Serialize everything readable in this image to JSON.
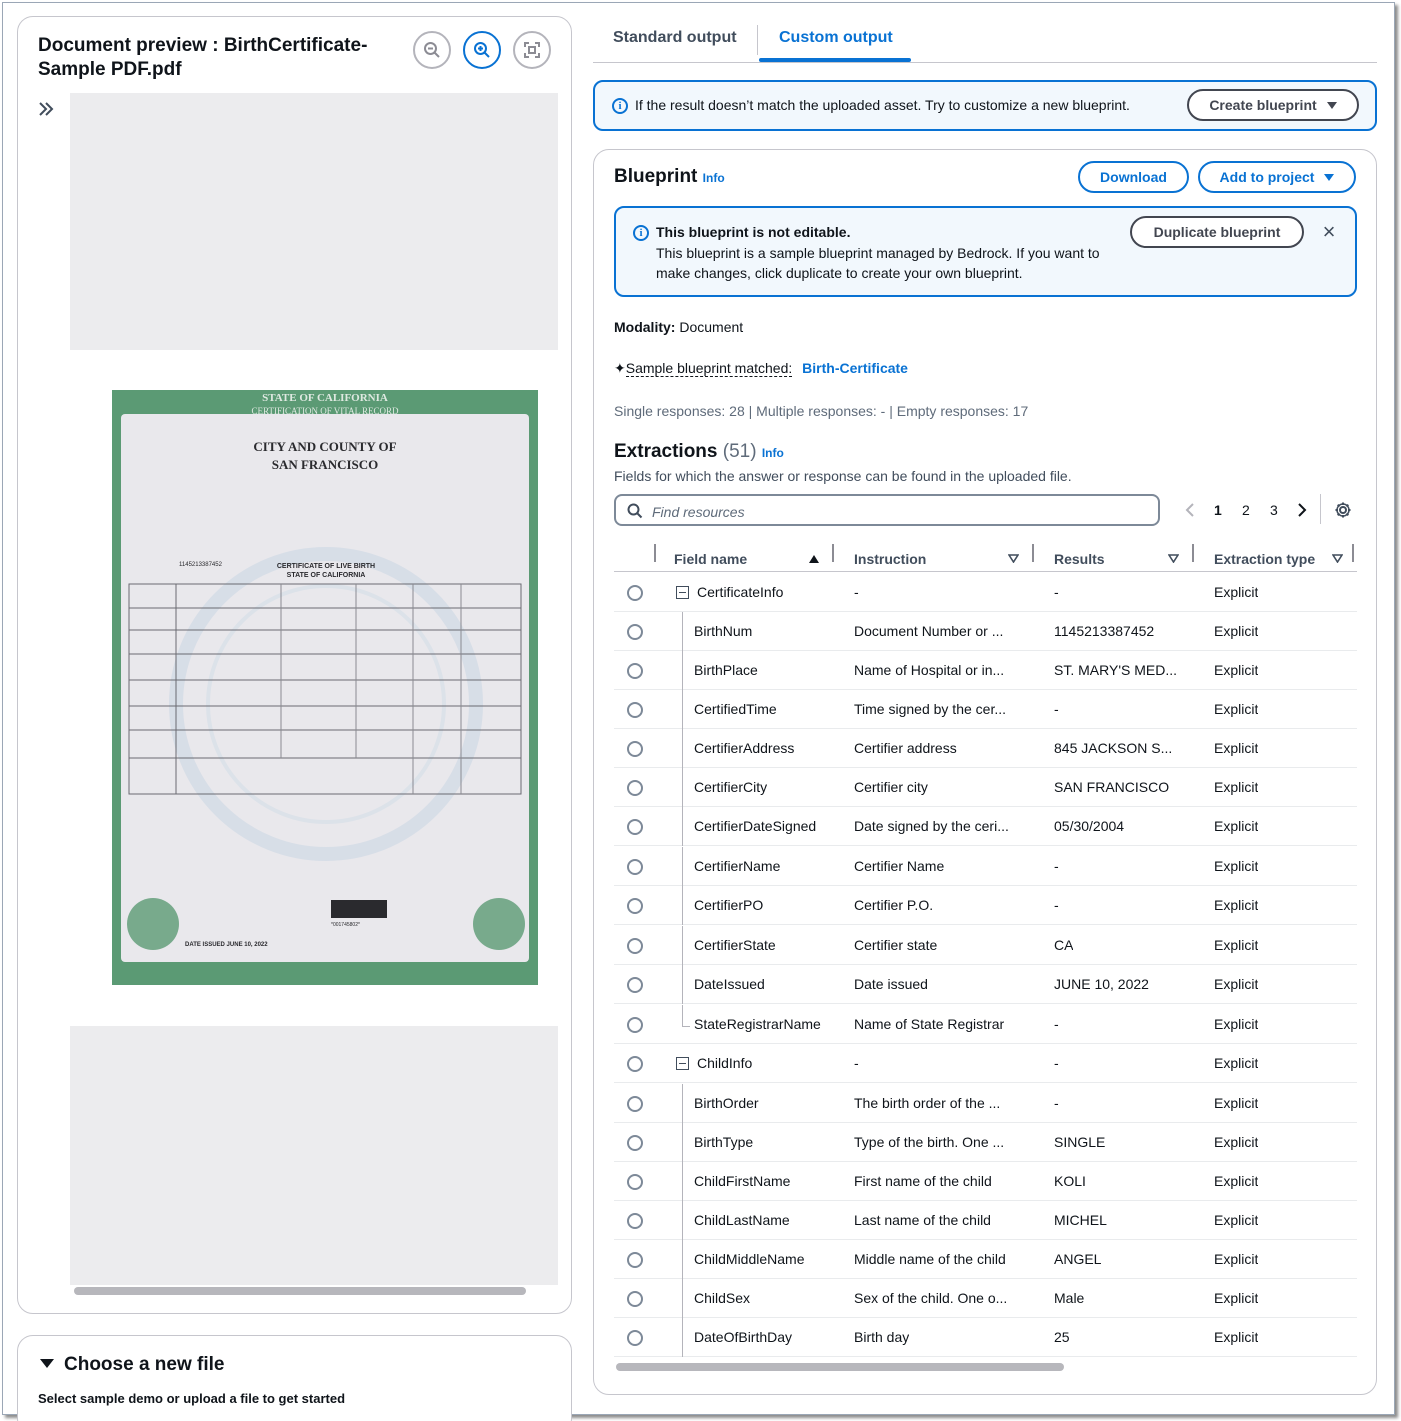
{
  "preview": {
    "title": "Document preview : BirthCertificate-Sample PDF.pdf",
    "zoom_out_icon": "zoom-out-icon",
    "zoom_in_icon": "zoom-in-icon",
    "fit_icon": "fit-screen-icon",
    "expand_icon": "double-chevron-right-icon",
    "document": {
      "header_line1": "STATE OF CALIFORNIA",
      "header_line2": "CERTIFICATION OF VITAL RECORD",
      "county_line1": "CITY AND COUNTY OF",
      "county_line2": "SAN FRANCISCO",
      "cert_title1": "CERTIFICATE OF LIVE BIRTH",
      "cert_title2": "STATE OF CALIFORNIA",
      "state_file_number": "1145213387452",
      "date_issued": "DATE ISSUED  JUNE 10, 2022",
      "barcode_number": "*001745802*",
      "colors": {
        "border": "#5b9a74",
        "paper": "#e9e8ec"
      }
    }
  },
  "choose_file": {
    "title": "Choose a new file",
    "subtitle": "Select sample demo or upload a file to get started"
  },
  "tabs": [
    {
      "label": "Standard output",
      "active": false
    },
    {
      "label": "Custom output",
      "active": true
    }
  ],
  "info_banner": {
    "text": "If the result doesn’t match the uploaded asset. Try to customize a new blueprint.",
    "button": "Create blueprint"
  },
  "blueprint": {
    "title": "Blueprint",
    "info": "Info",
    "download": "Download",
    "add_to_project": "Add to project",
    "alert": {
      "title": "This blueprint is not editable.",
      "body": "This blueprint is a sample blueprint managed by Bedrock. If you want to make changes, click duplicate to create your own blueprint.",
      "button": "Duplicate blueprint"
    },
    "modality_label": "Modality:",
    "modality_value": "Document",
    "matched_label": "Sample blueprint matched:",
    "matched_value": "Birth-Certificate",
    "stats": "Single responses: 28 | Multiple responses: - | Empty responses: 17"
  },
  "extractions": {
    "title": "Extractions",
    "count": "(51)",
    "info": "Info",
    "description": "Fields for which the answer or response can be found in the uploaded file.",
    "search_placeholder": "Find resources",
    "pages": [
      "1",
      "2",
      "3"
    ],
    "current_page": "1",
    "columns": [
      "Field name",
      "Instruction",
      "Results",
      "Extraction type"
    ],
    "rows": [
      {
        "field": "CertificateInfo",
        "instruction": "-",
        "result": "-",
        "type": "Explicit",
        "group": true
      },
      {
        "field": "BirthNum",
        "instruction": "Document Number or ...",
        "result": "1145213387452",
        "type": "Explicit"
      },
      {
        "field": "BirthPlace",
        "instruction": "Name of Hospital or in...",
        "result": "ST. MARY'S MED...",
        "type": "Explicit"
      },
      {
        "field": "CertifiedTime",
        "instruction": "Time signed by the cer...",
        "result": "-",
        "type": "Explicit"
      },
      {
        "field": "CertifierAddress",
        "instruction": "Certifier address",
        "result": "845 JACKSON S...",
        "type": "Explicit"
      },
      {
        "field": "CertifierCity",
        "instruction": "Certifier city",
        "result": "SAN FRANCISCO",
        "type": "Explicit"
      },
      {
        "field": "CertifierDateSigned",
        "instruction": "Date signed by the ceri...",
        "result": "05/30/2004",
        "type": "Explicit"
      },
      {
        "field": "CertifierName",
        "instruction": "Certifier Name",
        "result": "-",
        "type": "Explicit"
      },
      {
        "field": "CertifierPO",
        "instruction": "Certifier P.O.",
        "result": "-",
        "type": "Explicit"
      },
      {
        "field": "CertifierState",
        "instruction": "Certifier state",
        "result": "CA",
        "type": "Explicit"
      },
      {
        "field": "DateIssued",
        "instruction": "Date issued",
        "result": "JUNE 10, 2022",
        "type": "Explicit"
      },
      {
        "field": "StateRegistrarName",
        "instruction": "Name of State Registrar",
        "result": "-",
        "type": "Explicit",
        "last": true
      },
      {
        "field": "ChildInfo",
        "instruction": "-",
        "result": "-",
        "type": "Explicit",
        "group": true
      },
      {
        "field": "BirthOrder",
        "instruction": "The birth order of the ...",
        "result": "-",
        "type": "Explicit"
      },
      {
        "field": "BirthType",
        "instruction": "Type of the birth. One ...",
        "result": "SINGLE",
        "type": "Explicit"
      },
      {
        "field": "ChildFirstName",
        "instruction": "First name of the child",
        "result": "KOLI",
        "type": "Explicit"
      },
      {
        "field": "ChildLastName",
        "instruction": "Last name of the child",
        "result": "MICHEL",
        "type": "Explicit"
      },
      {
        "field": "ChildMiddleName",
        "instruction": "Middle name of the child",
        "result": "ANGEL",
        "type": "Explicit"
      },
      {
        "field": "ChildSex",
        "instruction": "Sex of the child. One o...",
        "result": "Male",
        "type": "Explicit"
      },
      {
        "field": "DateOfBirthDay",
        "instruction": "Birth day",
        "result": "25",
        "type": "Explicit"
      }
    ]
  },
  "colors": {
    "accent": "#0972d3",
    "banner_bg": "#f2f8fd",
    "text": "#0f141a"
  }
}
